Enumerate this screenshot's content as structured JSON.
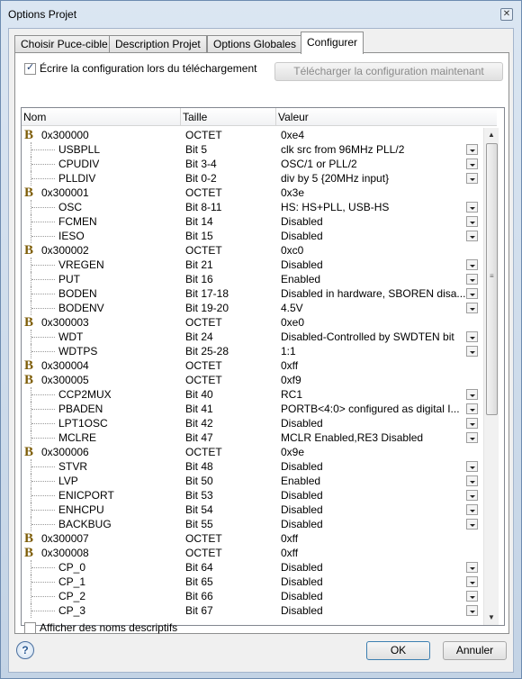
{
  "window": {
    "title": "Options Projet",
    "close_glyph": "✕"
  },
  "tabs": [
    "Choisir Puce-cible",
    "Description Projet",
    "Options Globales",
    "Configurer"
  ],
  "active_tab": "Configurer",
  "write_config": {
    "label": "Écrire la configuration lors du téléchargement",
    "checked": true
  },
  "download_button": "Télécharger la configuration maintenant",
  "columns": [
    "Nom",
    "Taille",
    "Valeur"
  ],
  "group_icon": "B",
  "rows": [
    {
      "type": "group",
      "name": "0x300000",
      "size": "OCTET",
      "value": "0xe4"
    },
    {
      "type": "item",
      "name": "USBPLL",
      "size": "Bit 5",
      "value": "clk src from 96MHz PLL/2"
    },
    {
      "type": "item",
      "name": "CPUDIV",
      "size": "Bit 3-4",
      "value": "OSC/1 or PLL/2"
    },
    {
      "type": "item",
      "name": "PLLDIV",
      "size": "Bit 0-2",
      "value": "div by 5 {20MHz input}"
    },
    {
      "type": "group",
      "name": "0x300001",
      "size": "OCTET",
      "value": "0x3e"
    },
    {
      "type": "item",
      "name": "OSC",
      "size": "Bit 8-11",
      "value": "HS: HS+PLL, USB-HS"
    },
    {
      "type": "item",
      "name": "FCMEN",
      "size": "Bit 14",
      "value": "Disabled"
    },
    {
      "type": "item",
      "name": "IESO",
      "size": "Bit 15",
      "value": "Disabled"
    },
    {
      "type": "group",
      "name": "0x300002",
      "size": "OCTET",
      "value": "0xc0"
    },
    {
      "type": "item",
      "name": "VREGEN",
      "size": "Bit 21",
      "value": "Disabled"
    },
    {
      "type": "item",
      "name": "PUT",
      "size": "Bit 16",
      "value": "Enabled"
    },
    {
      "type": "item",
      "name": "BODEN",
      "size": "Bit 17-18",
      "value": "Disabled in hardware, SBOREN disa..."
    },
    {
      "type": "item",
      "name": "BODENV",
      "size": "Bit 19-20",
      "value": "4.5V"
    },
    {
      "type": "group",
      "name": "0x300003",
      "size": "OCTET",
      "value": "0xe0"
    },
    {
      "type": "item",
      "name": "WDT",
      "size": "Bit 24",
      "value": "Disabled-Controlled by SWDTEN bit"
    },
    {
      "type": "item",
      "name": "WDTPS",
      "size": "Bit 25-28",
      "value": "1:1"
    },
    {
      "type": "group",
      "name": "0x300004",
      "size": "OCTET",
      "value": "0xff"
    },
    {
      "type": "group",
      "name": "0x300005",
      "size": "OCTET",
      "value": "0xf9"
    },
    {
      "type": "item",
      "name": "CCP2MUX",
      "size": "Bit 40",
      "value": "RC1"
    },
    {
      "type": "item",
      "name": "PBADEN",
      "size": "Bit 41",
      "value": "PORTB<4:0> configured as digital I..."
    },
    {
      "type": "item",
      "name": "LPT1OSC",
      "size": "Bit 42",
      "value": "Disabled"
    },
    {
      "type": "item",
      "name": "MCLRE",
      "size": "Bit 47",
      "value": "MCLR Enabled,RE3 Disabled"
    },
    {
      "type": "group",
      "name": "0x300006",
      "size": "OCTET",
      "value": "0x9e"
    },
    {
      "type": "item",
      "name": "STVR",
      "size": "Bit 48",
      "value": "Disabled"
    },
    {
      "type": "item",
      "name": "LVP",
      "size": "Bit 50",
      "value": "Enabled"
    },
    {
      "type": "item",
      "name": "ENICPORT",
      "size": "Bit 53",
      "value": "Disabled"
    },
    {
      "type": "item",
      "name": "ENHCPU",
      "size": "Bit 54",
      "value": "Disabled"
    },
    {
      "type": "item",
      "name": "BACKBUG",
      "size": "Bit 55",
      "value": "Disabled"
    },
    {
      "type": "group",
      "name": "0x300007",
      "size": "OCTET",
      "value": "0xff"
    },
    {
      "type": "group",
      "name": "0x300008",
      "size": "OCTET",
      "value": "0xff"
    },
    {
      "type": "item",
      "name": "CP_0",
      "size": "Bit 64",
      "value": "Disabled"
    },
    {
      "type": "item",
      "name": "CP_1",
      "size": "Bit 65",
      "value": "Disabled"
    },
    {
      "type": "item",
      "name": "CP_2",
      "size": "Bit 66",
      "value": "Disabled"
    },
    {
      "type": "item",
      "name": "CP_3",
      "size": "Bit 67",
      "value": "Disabled"
    }
  ],
  "descriptive_names": {
    "label": "Afficher des noms descriptifs",
    "checked": false
  },
  "ok_button": "OK",
  "cancel_button": "Annuler",
  "help_icon_glyph": "?"
}
